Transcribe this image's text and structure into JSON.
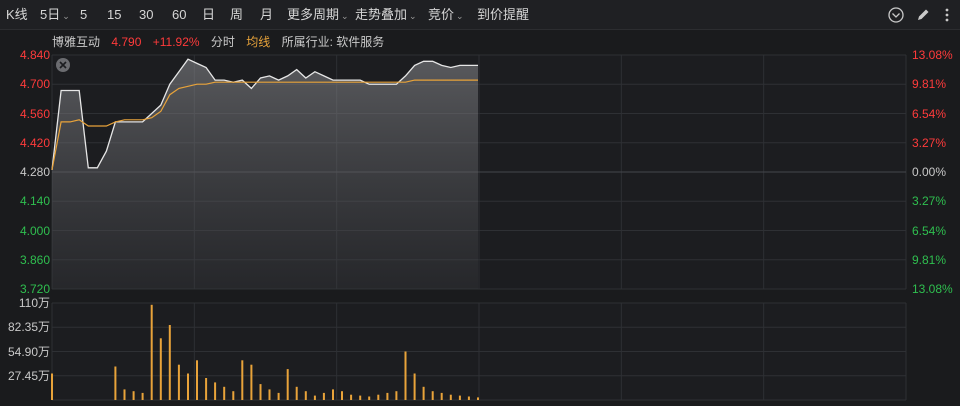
{
  "toolbar": {
    "items": [
      {
        "label": "K线",
        "caret": false
      },
      {
        "label": "5日",
        "caret": true
      },
      {
        "label": "5",
        "caret": false
      },
      {
        "label": "15",
        "caret": false
      },
      {
        "label": "30",
        "caret": false
      },
      {
        "label": "60",
        "caret": false
      },
      {
        "label": "日",
        "caret": false
      },
      {
        "label": "周",
        "caret": false
      },
      {
        "label": "月",
        "caret": false
      },
      {
        "label": "更多周期",
        "caret": true
      },
      {
        "label": "走势叠加",
        "caret": true
      },
      {
        "label": "竞价",
        "caret": true
      },
      {
        "label": "到价提醒",
        "caret": false
      }
    ],
    "icons": [
      "chevron-circle-icon",
      "pen-icon",
      "more-icon"
    ]
  },
  "info": {
    "name": "博雅互动",
    "price": "4.790",
    "change_pct": "+11.92%",
    "fenshi": "分时",
    "junxian": "均线",
    "industry": "所属行业: 软件服务"
  },
  "axes": {
    "price_ticks": [
      "4.840",
      "4.700",
      "4.560",
      "4.420",
      "4.280",
      "4.140",
      "4.000",
      "3.860",
      "3.720"
    ],
    "pct_ticks": [
      "13.08%",
      "9.81%",
      "6.54%",
      "3.27%",
      "0.00%",
      "3.27%",
      "6.54%",
      "9.81%",
      "13.08%"
    ],
    "volume_ticks": [
      "110万",
      "82.35万",
      "54.90万",
      "27.45万"
    ]
  },
  "colors": {
    "up": "#ff3b3b",
    "down": "#2fbf4f",
    "neutral": "#c9c9c9",
    "avg_line": "#e8a33a",
    "volume_bar": "#e8a33a",
    "grid": "#2e3034"
  },
  "chart_data": {
    "type": "line",
    "prev_close": 4.28,
    "ylim": [
      3.72,
      4.84
    ],
    "price": [
      4.29,
      4.67,
      4.67,
      4.67,
      4.3,
      4.3,
      4.38,
      4.52,
      4.52,
      4.52,
      4.52,
      4.56,
      4.6,
      4.7,
      4.76,
      4.82,
      4.8,
      4.78,
      4.72,
      4.72,
      4.71,
      4.72,
      4.68,
      4.73,
      4.74,
      4.72,
      4.74,
      4.77,
      4.73,
      4.76,
      4.74,
      4.72,
      4.72,
      4.72,
      4.72,
      4.7,
      4.7,
      4.7,
      4.7,
      4.74,
      4.79,
      4.81,
      4.81,
      4.79,
      4.78,
      4.79,
      4.79,
      4.79
    ],
    "avg": [
      4.29,
      4.52,
      4.52,
      4.53,
      4.5,
      4.5,
      4.5,
      4.52,
      4.53,
      4.53,
      4.53,
      4.54,
      4.57,
      4.65,
      4.68,
      4.69,
      4.7,
      4.7,
      4.71,
      4.71,
      4.71,
      4.71,
      4.71,
      4.71,
      4.71,
      4.71,
      4.71,
      4.71,
      4.71,
      4.71,
      4.71,
      4.71,
      4.71,
      4.71,
      4.71,
      4.71,
      4.71,
      4.71,
      4.71,
      4.71,
      4.72,
      4.72,
      4.72,
      4.72,
      4.72,
      4.72,
      4.72,
      4.72
    ],
    "volume_ylim": [
      0,
      110
    ],
    "volume": [
      30,
      0,
      0,
      0,
      0,
      0,
      0,
      38,
      12,
      10,
      8,
      108,
      70,
      85,
      40,
      30,
      45,
      25,
      20,
      15,
      10,
      45,
      40,
      18,
      12,
      8,
      35,
      15,
      10,
      5,
      8,
      12,
      10,
      6,
      5,
      4,
      6,
      8,
      10,
      55,
      30,
      15,
      10,
      8,
      6,
      5,
      4,
      3
    ]
  }
}
